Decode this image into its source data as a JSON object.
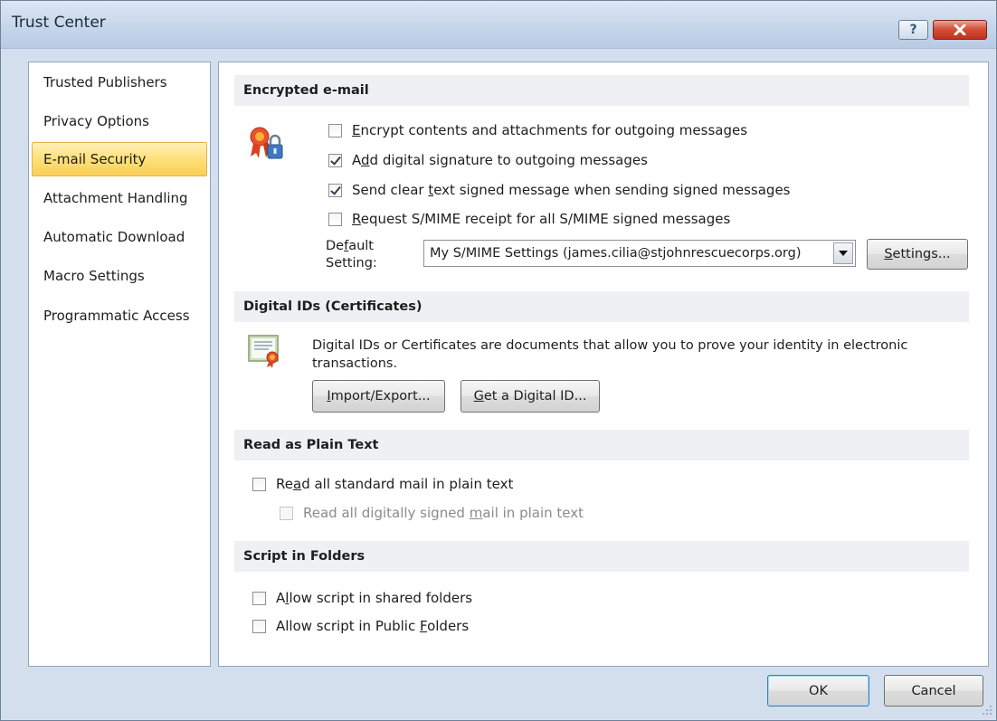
{
  "window": {
    "title": "Trust Center",
    "help_glyph": "?"
  },
  "sidebar": {
    "items": [
      {
        "label": "Trusted Publishers"
      },
      {
        "label": "Privacy Options"
      },
      {
        "label": "E-mail Security",
        "selected": true
      },
      {
        "label": "Attachment Handling"
      },
      {
        "label": "Automatic Download"
      },
      {
        "label": "Macro Settings"
      },
      {
        "label": "Programmatic Access"
      }
    ]
  },
  "encrypted": {
    "header": "Encrypted e-mail",
    "options": [
      {
        "pre": "",
        "key": "E",
        "post": "ncrypt contents and attachments for outgoing messages",
        "checked": false
      },
      {
        "pre": "A",
        "key": "d",
        "post": "d digital signature to outgoing messages",
        "checked": true
      },
      {
        "pre": "Send clear ",
        "key": "t",
        "post": "ext signed message when sending signed messages",
        "checked": true
      },
      {
        "pre": "",
        "key": "R",
        "post": "equest S/MIME receipt for all S/MIME signed messages",
        "checked": false
      }
    ],
    "default_label_pre": "De",
    "default_label_key": "f",
    "default_label_post": "ault",
    "default_label_line2": "Setting:",
    "default_value": "My S/MIME Settings (james.cilia@stjohnrescuecorps.org)",
    "settings_pre": "",
    "settings_key": "S",
    "settings_post": "ettings..."
  },
  "digital_ids": {
    "header": "Digital IDs (Certificates)",
    "description": "Digital IDs or Certificates are documents that allow you to prove your identity in electronic transactions.",
    "import_key": "I",
    "import_post": "mport/Export...",
    "get_key": "G",
    "get_post": "et a Digital ID..."
  },
  "plain_text": {
    "header": "Read as Plain Text",
    "read_all_pre": "Re",
    "read_all_key": "a",
    "read_all_post": "d all standard mail in plain text",
    "read_all_checked": false,
    "read_signed_pre": "Read all digitally signed ",
    "read_signed_key": "m",
    "read_signed_post": "ail in plain text",
    "read_signed_checked": false,
    "read_signed_disabled": true
  },
  "script": {
    "header": "Script in Folders",
    "shared_pre": "A",
    "shared_key": "l",
    "shared_post": "low script in shared folders",
    "shared_checked": false,
    "public_pre": "Allow script in Public ",
    "public_key": "F",
    "public_post": "olders",
    "public_checked": false
  },
  "footer": {
    "ok_label": "OK",
    "cancel_label": "Cancel"
  },
  "colors": {
    "selected_item": "#f9cf56",
    "section_header_bg": "#eef0f3",
    "close_button": "#c0321d"
  }
}
